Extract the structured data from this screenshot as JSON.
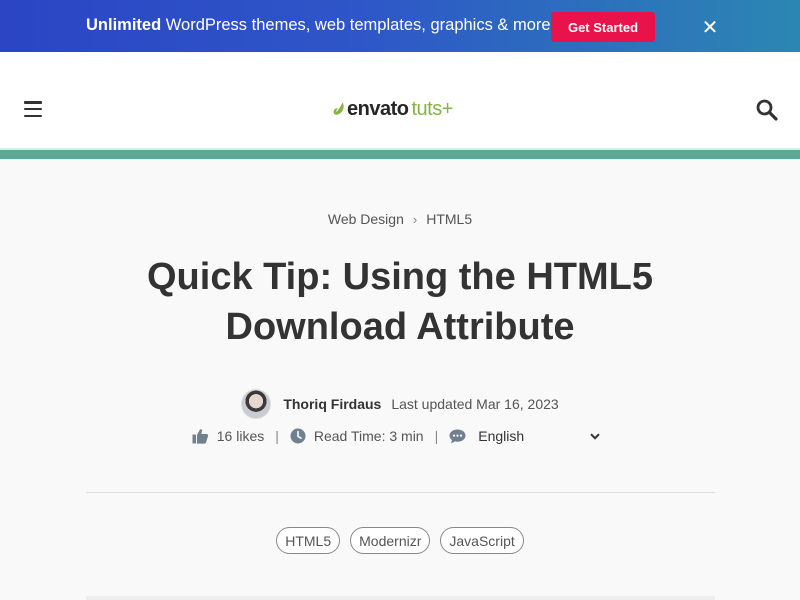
{
  "promo": {
    "bold": "Unlimited",
    "text": " WordPress themes, web templates, graphics & more!",
    "cta_label": "Get Started",
    "close_glyph": "✕"
  },
  "header": {
    "logo_main": "envato",
    "logo_sub": "tuts+",
    "icons": [
      "menu-icon",
      "search-icon",
      "envato-leaf-icon"
    ],
    "accent_color": "#5ca993"
  },
  "breadcrumb": {
    "items": [
      "Web Design",
      "HTML5"
    ],
    "separator": "›"
  },
  "article": {
    "title": "Quick Tip: Using the HTML5 Download Attribute",
    "author": "Thoriq Firdaus",
    "updated": "Last updated Mar 16, 2023",
    "likes": "16 likes",
    "read_time": "Read Time: 3 min",
    "language": "English",
    "separator": "|",
    "tags": [
      "HTML5",
      "Modernizr",
      "JavaScript"
    ]
  }
}
